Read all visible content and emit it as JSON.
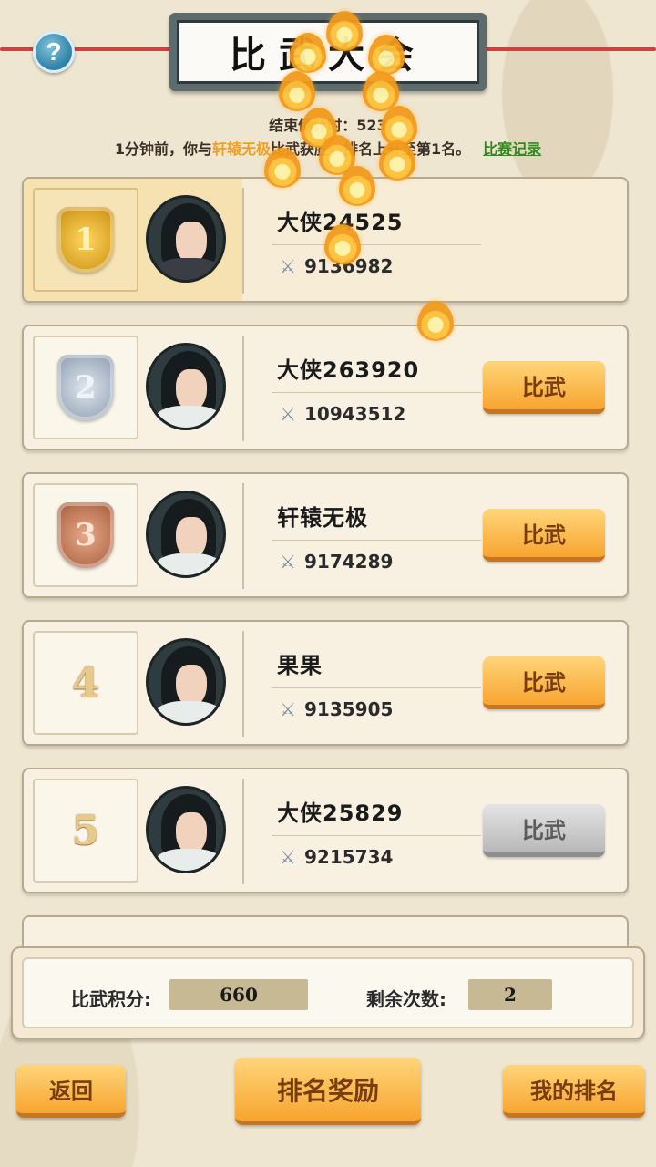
{
  "header": {
    "help_glyph": "?",
    "title": "比武大会",
    "end_time": "结束倒计时：523",
    "notice_prefix": "1分钟前，你与",
    "notice_name": "轩辕无极",
    "notice_suffix": "比武获胜，排名上升至第1名。",
    "record_link": "比赛记录"
  },
  "rankings": [
    {
      "rank": "1",
      "name": "大侠24525",
      "power": "9136982",
      "medal": "gold",
      "button": null
    },
    {
      "rank": "2",
      "name": "大侠263920",
      "power": "10943512",
      "medal": "silver",
      "button": "比武"
    },
    {
      "rank": "3",
      "name": "轩辕无极",
      "power": "9174289",
      "medal": "bronze",
      "button": "比武"
    },
    {
      "rank": "4",
      "name": "果果",
      "power": "9135905",
      "medal": null,
      "button": "比武"
    },
    {
      "rank": "5",
      "name": "大侠25829",
      "power": "9215734",
      "medal": null,
      "button": "比武",
      "disabled": true
    }
  ],
  "stats": {
    "score_label": "比武积分:",
    "score_value": "660",
    "remaining_label": "剩余次数:",
    "remaining_value": "2"
  },
  "footer": {
    "back": "返回",
    "rewards": "排名奖励",
    "my_rank": "我的排名"
  },
  "icons": {
    "power": "crossed-swords-icon",
    "help": "help-icon"
  },
  "colors": {
    "highlight": "#f0a020",
    "link": "#2e8b1e",
    "button": "#f7a52f"
  }
}
